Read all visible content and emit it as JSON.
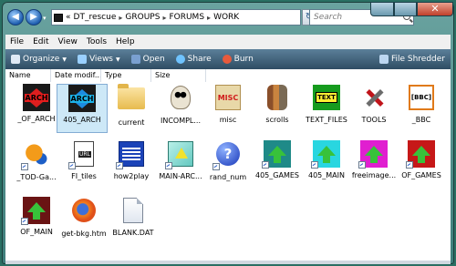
{
  "nav": {
    "back_arrow": "◀",
    "forward_arrow": "▶",
    "drop_arrow": "▾"
  },
  "address": {
    "prefix": "«",
    "crumbs": [
      "DT_rescue",
      "GROUPS",
      "FORUMS",
      "WORK"
    ],
    "separator": "▸",
    "refresh_glyph": "↻"
  },
  "search": {
    "placeholder": "Search"
  },
  "window_controls": {
    "close_glyph": "✕"
  },
  "menu": [
    "File",
    "Edit",
    "View",
    "Tools",
    "Help"
  ],
  "toolbar": {
    "organize": "Organize",
    "views": "Views",
    "open": "Open",
    "share": "Share",
    "burn": "Burn",
    "file_shredder": "File Shredder",
    "colors": {
      "organize": "#dfe9f5",
      "views": "#9ad0ff",
      "open": "#7aa0d0",
      "share": "#6fc3ff",
      "burn": "#e85a3c",
      "shredder": "#bcd6f0"
    }
  },
  "columns": [
    "Name",
    "Date modif...",
    "Type",
    "Size"
  ],
  "items": [
    {
      "label": "_OF_ARCH",
      "icon": "arch-red-icon",
      "selected": false
    },
    {
      "label": "405_ARCH",
      "icon": "arch-blue-icon",
      "selected": true
    },
    {
      "label": "current",
      "icon": "folder-icon",
      "selected": false
    },
    {
      "label": "INCOMPL...",
      "icon": "skull-icon",
      "selected": false
    },
    {
      "label": "misc",
      "icon": "misc-icon",
      "selected": false
    },
    {
      "label": "scrolls",
      "icon": "scrolls-icon",
      "selected": false
    },
    {
      "label": "TEXT_FILES",
      "icon": "text-files-icon",
      "selected": false
    },
    {
      "label": "TOOLS",
      "icon": "tools-icon",
      "selected": false
    },
    {
      "label": "_BBC",
      "icon": "bbc-icon",
      "selected": false
    },
    {
      "label": "_TOD-Ga...",
      "icon": "garfield-icon",
      "selected": false
    },
    {
      "label": "FI_tiles",
      "icon": "url-icon",
      "selected": false
    },
    {
      "label": "how2play",
      "icon": "how2play-icon",
      "selected": false
    },
    {
      "label": "MAIN-ARC...",
      "icon": "main-arc-icon",
      "selected": false
    },
    {
      "label": "rand_num",
      "icon": "rand-num-icon",
      "selected": false
    },
    {
      "label": "405_GAMES",
      "icon": "arrow-teal-icon",
      "selected": false
    },
    {
      "label": "405_MAIN",
      "icon": "arrow-cyan-icon",
      "selected": false
    },
    {
      "label": "freeimage...",
      "icon": "arrow-magenta-icon",
      "selected": false
    },
    {
      "label": "OF_GAMES",
      "icon": "arrow-red-icon",
      "selected": false
    },
    {
      "label": "OF_MAIN",
      "icon": "arrow-darkred-icon",
      "selected": false
    },
    {
      "label": "get-bkg.htm",
      "icon": "firefox-icon",
      "selected": false
    },
    {
      "label": "BLANK.DAT",
      "icon": "dat-file-icon",
      "selected": false
    }
  ],
  "icon_text": {
    "arch": "ARCH",
    "misc": "MISC",
    "text_files": "TEXT",
    "bbc": "[BBC]",
    "url": "URL",
    "rand_num": "?"
  }
}
